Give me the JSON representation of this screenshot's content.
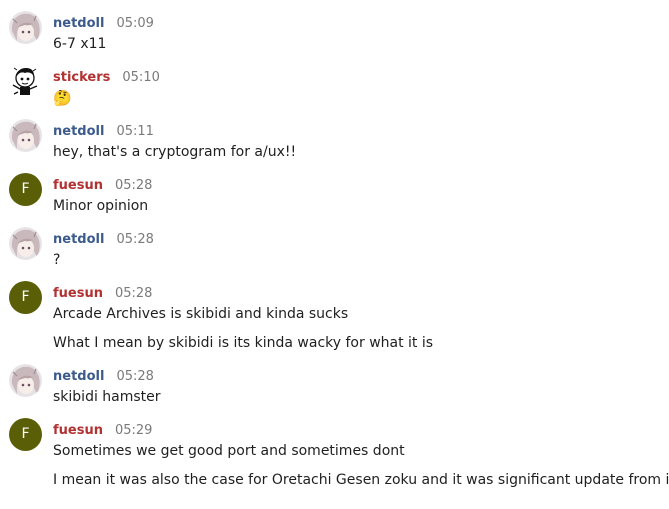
{
  "colors": {
    "netdoll": "#3c5b8b",
    "stickers": "#b23232",
    "fuesun": "#b23232",
    "avatar_letter_bg": "#5a5e07"
  },
  "messages": [
    {
      "nick": "netdoll",
      "time": "05:09",
      "avatar": "anime-avatar",
      "lines": [
        "6-7 x11"
      ]
    },
    {
      "nick": "stickers",
      "time": "05:10",
      "avatar": "sticker-avatar",
      "lines": [
        "🤔"
      ]
    },
    {
      "nick": "netdoll",
      "time": "05:11",
      "avatar": "anime-avatar",
      "lines": [
        "hey, that's a cryptogram for a/ux!!"
      ]
    },
    {
      "nick": "fuesun",
      "time": "05:28",
      "avatar": "letter",
      "avatar_letter": "F",
      "lines": [
        "Minor opinion"
      ]
    },
    {
      "nick": "netdoll",
      "time": "05:28",
      "avatar": "anime-avatar",
      "lines": [
        "?"
      ]
    },
    {
      "nick": "fuesun",
      "time": "05:28",
      "avatar": "letter",
      "avatar_letter": "F",
      "lines": [
        "Arcade Archives is skibidi and kinda sucks",
        "What I mean by skibidi is its kinda wacky for what it is"
      ]
    },
    {
      "nick": "netdoll",
      "time": "05:28",
      "avatar": "anime-avatar",
      "lines": [
        "skibidi hamster"
      ]
    },
    {
      "nick": "fuesun",
      "time": "05:29",
      "avatar": "letter",
      "avatar_letter": "F",
      "lines": [
        "Sometimes we get good port and sometimes dont",
        "I mean it was also the case for Oretachi Gesen zoku and it was significant update from it"
      ]
    }
  ]
}
